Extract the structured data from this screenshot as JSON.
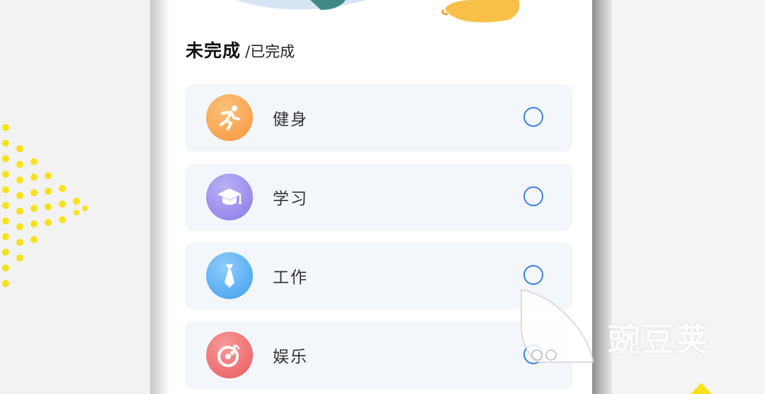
{
  "tabs": {
    "active": "未完成",
    "inactive": "/已完成"
  },
  "tasks": [
    {
      "label": "健身",
      "icon": "running-person-icon",
      "color": "#f6953d"
    },
    {
      "label": "学习",
      "icon": "graduation-cap-icon",
      "color": "#8a79ea"
    },
    {
      "label": "工作",
      "icon": "necktie-icon",
      "color": "#3f9ff0"
    },
    {
      "label": "娱乐",
      "icon": "music-disc-icon",
      "color": "#ea5a5c"
    }
  ],
  "watermark": {
    "text": "豌豆荚"
  },
  "colors": {
    "accent": "#3f7fe0",
    "card_bg": "#f3f7fc"
  }
}
